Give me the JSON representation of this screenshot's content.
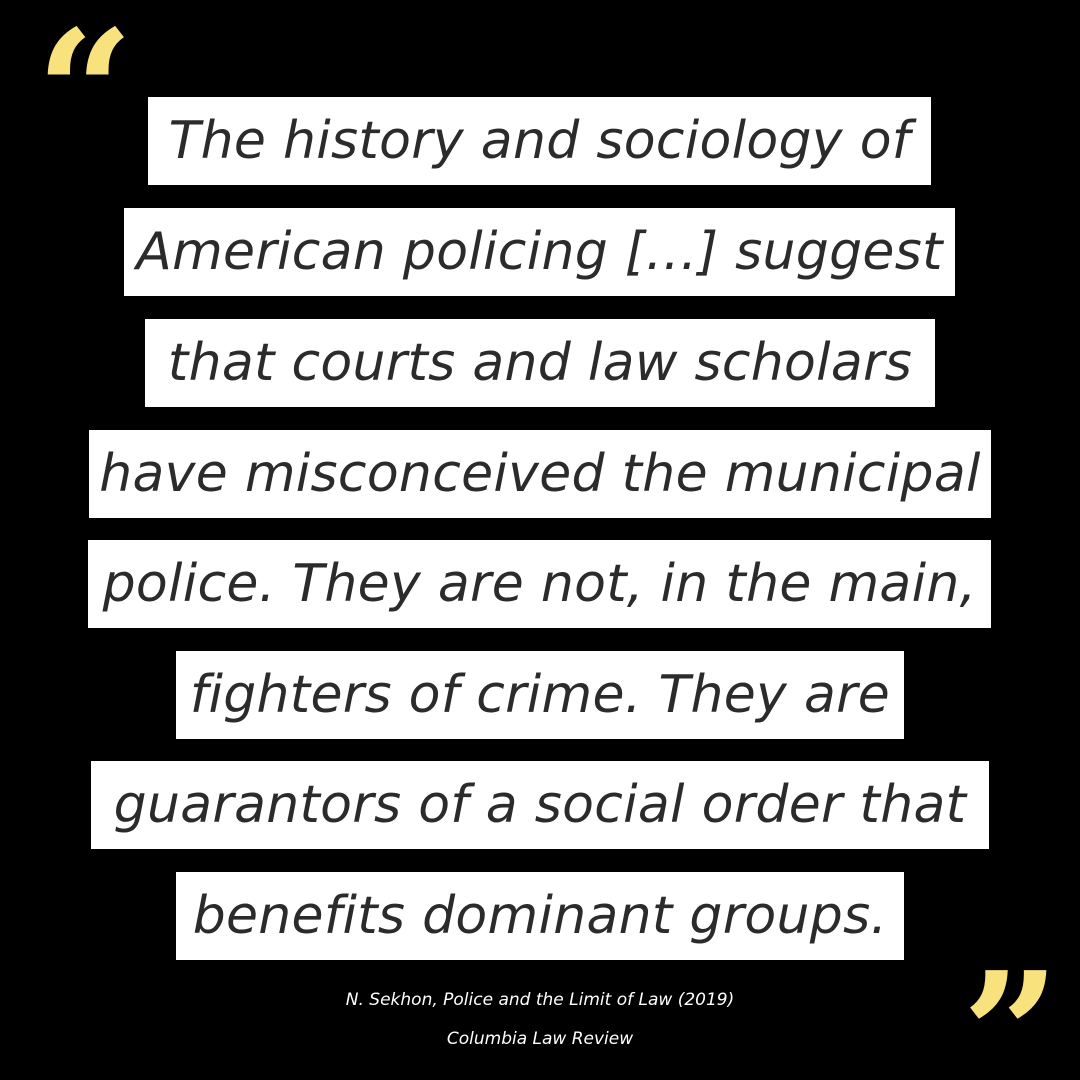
{
  "quote": {
    "open_mark": "“",
    "close_mark": "”",
    "lines": [
      "The history and sociology of",
      "American policing […] suggest",
      "that courts and law scholars",
      "have misconceived the municipal",
      "police. They are not, in the main,",
      "fighters of crime. They are",
      "guarantors of a social order that",
      "benefits dominant groups."
    ]
  },
  "citation": {
    "source": "N. Sekhon, Police and the Limit of Law (2019)",
    "journal": "Columbia Law Review"
  },
  "colors": {
    "background": "#000000",
    "quote_mark": "#f7e27d",
    "highlight": "#ffffff",
    "quote_text": "#2b2b2b",
    "citation_text": "#ffffff"
  }
}
